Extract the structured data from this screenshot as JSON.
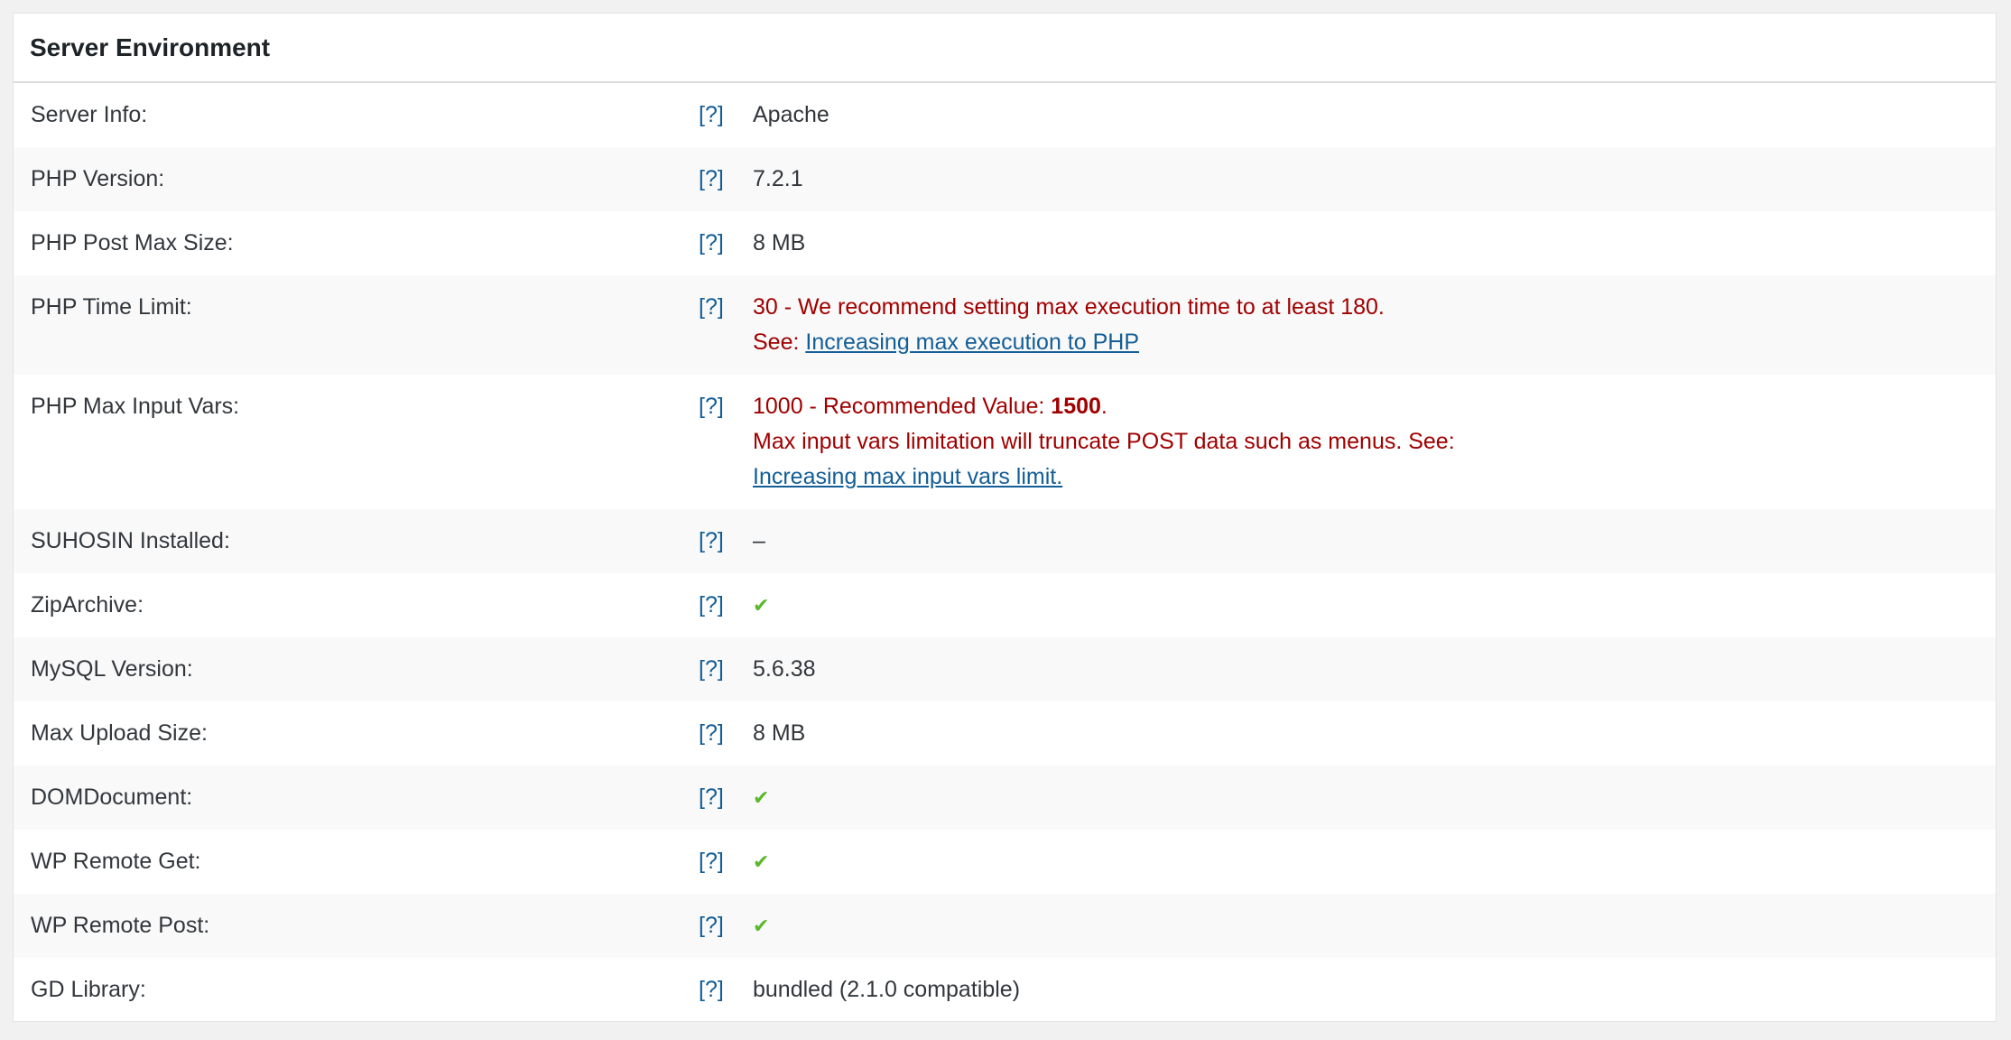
{
  "panel": {
    "title": "Server Environment"
  },
  "help_label": "[?]",
  "rows": [
    {
      "label": "Server Info:",
      "value": "Apache"
    },
    {
      "label": "PHP Version:",
      "value": "7.2.1"
    },
    {
      "label": "PHP Post Max Size:",
      "value": "8 MB"
    },
    {
      "label": "PHP Time Limit:",
      "line1": "30 - We recommend setting max execution time to at least 180.",
      "see_prefix": "See: ",
      "link": "Increasing max execution to PHP"
    },
    {
      "label": "PHP Max Input Vars:",
      "line1_prefix": "1000 - Recommended Value: ",
      "line1_bold": "1500",
      "line1_suffix": ".",
      "line2": "Max input vars limitation will truncate POST data such as menus. See:",
      "link": "Increasing max input vars limit."
    },
    {
      "label": "SUHOSIN Installed:",
      "value": "–"
    },
    {
      "label": "ZipArchive:",
      "value": "✔"
    },
    {
      "label": "MySQL Version:",
      "value": "5.6.38"
    },
    {
      "label": "Max Upload Size:",
      "value": "8 MB"
    },
    {
      "label": "DOMDocument:",
      "value": "✔"
    },
    {
      "label": "WP Remote Get:",
      "value": "✔"
    },
    {
      "label": "WP Remote Post:",
      "value": "✔"
    },
    {
      "label": "GD Library:",
      "value": "bundled (2.1.0 compatible)"
    }
  ],
  "colors": {
    "error": "#a00000",
    "link": "#135e96",
    "check": "#5ab82b"
  }
}
